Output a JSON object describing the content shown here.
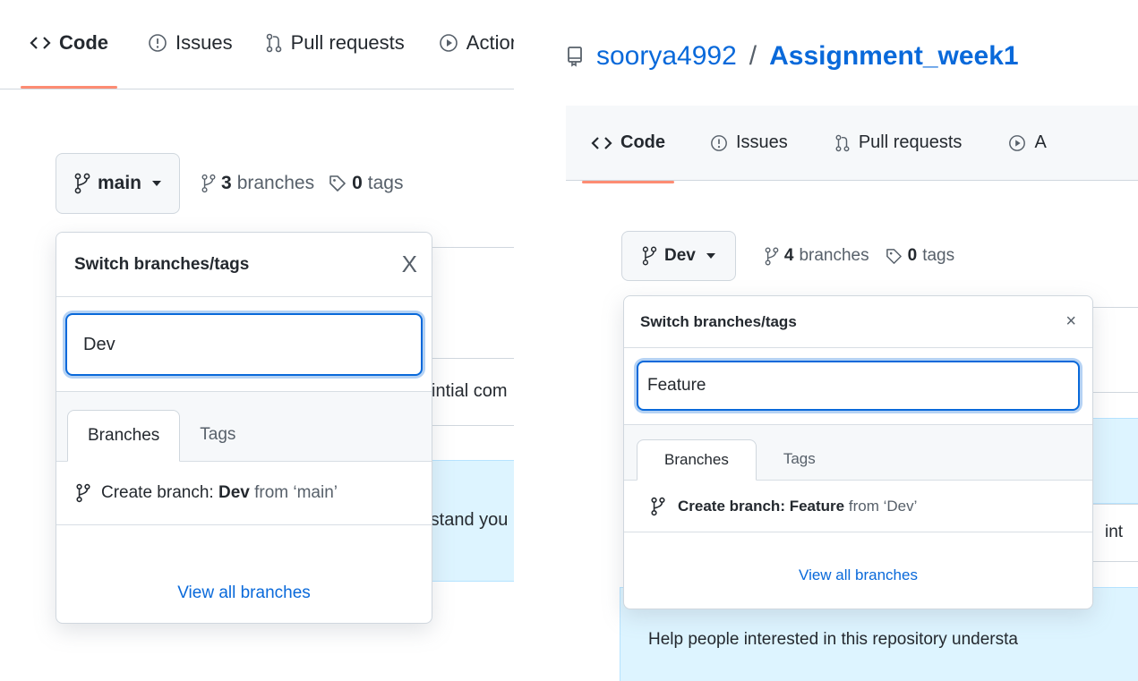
{
  "left": {
    "tabs": [
      {
        "label": "Code",
        "active": true
      },
      {
        "label": "Issues"
      },
      {
        "label": "Pull requests"
      },
      {
        "label": "Actions"
      }
    ],
    "branch_button": "main",
    "branches_count": "3",
    "branches_label": "branches",
    "tags_count": "0",
    "tags_label": "tags",
    "bg_text_1": "intial com",
    "bg_text_2": "rstand you",
    "dropdown": {
      "title": "Switch branches/tags",
      "close_glyph": "X",
      "filter_value": "Dev",
      "tab_branches": "Branches",
      "tab_tags": "Tags",
      "create_prefix": "Create branch:",
      "create_name": "Dev",
      "create_from": "from ‘main’",
      "footer_link": "View all branches"
    }
  },
  "right": {
    "owner": "soorya4992",
    "separator": "/",
    "repo": "Assignment_week1",
    "tabs": [
      {
        "label": "Code",
        "active": true
      },
      {
        "label": "Issues"
      },
      {
        "label": "Pull requests"
      },
      {
        "label": "A"
      }
    ],
    "branch_button": "Dev",
    "branches_count": "4",
    "branches_label": "branches",
    "tags_count": "0",
    "tags_label": "tags",
    "bg_text_1": "int",
    "bg_text_2": "Help people interested in this repository understa",
    "dropdown": {
      "title": "Switch branches/tags",
      "close_glyph": "×",
      "filter_value": "Feature",
      "tab_branches": "Branches",
      "tab_tags": "Tags",
      "create_prefix": "Create branch:",
      "create_name": "Feature",
      "create_from": "from ‘Dev’",
      "footer_link": "View all branches"
    }
  },
  "colors": {
    "accent_link": "#0969da",
    "active_tab_underline": "#fd8c73",
    "focus_ring": "#0969da",
    "banner_blue": "#ddf4ff"
  }
}
